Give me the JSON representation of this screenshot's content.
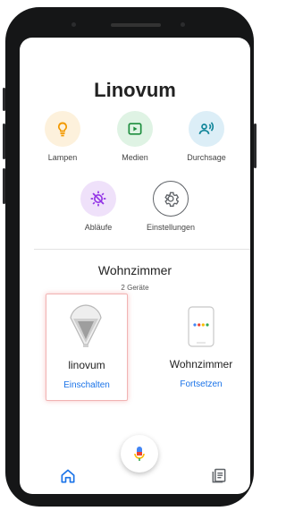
{
  "app": {
    "title": "Linovum"
  },
  "actions": [
    {
      "label": "Lampen",
      "icon": "lamp-icon",
      "bg": "#fdf1dc",
      "fg": "#f29900"
    },
    {
      "label": "Medien",
      "icon": "media-play-icon",
      "bg": "#dff3e4",
      "fg": "#1e8e3e"
    },
    {
      "label": "Durchsage",
      "icon": "broadcast-icon",
      "bg": "#dceef7",
      "fg": "#12869a"
    },
    {
      "label": "Abläufe",
      "icon": "routines-icon",
      "bg": "#efe1fa",
      "fg": "#9334e6"
    },
    {
      "label": "Einstellungen",
      "icon": "gear-icon",
      "bg": "#ffffff",
      "fg": "#5f6368"
    }
  ],
  "room": {
    "name": "Wohnzimmer",
    "device_count": "2 Geräte"
  },
  "devices": [
    {
      "name": "linovum",
      "action": "Einschalten",
      "icon": "lamp-device-icon",
      "selected": true
    },
    {
      "name": "Wohnzimmer",
      "action": "Fortsetzen",
      "icon": "smart-display-icon",
      "selected": false
    }
  ],
  "mic": {
    "icon": "microphone-icon"
  },
  "nav": {
    "home_icon": "home-icon",
    "feed_icon": "feed-icon"
  },
  "colors": {
    "accent": "#1a73e8",
    "selection_border": "#f1b3b3"
  }
}
